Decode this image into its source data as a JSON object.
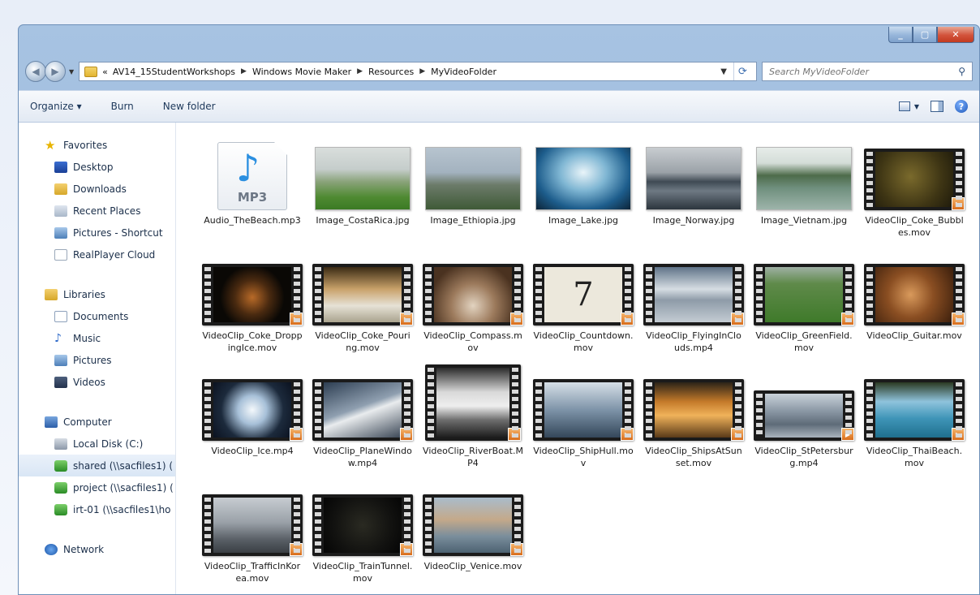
{
  "window": {
    "address": {
      "overflow": "«",
      "crumbs": [
        "AV14_15StudentWorkshops",
        "Windows Movie Maker",
        "Resources",
        "MyVideoFolder"
      ]
    },
    "search_placeholder": "Search MyVideoFolder"
  },
  "toolbar": {
    "organize": "Organize ▾",
    "burn": "Burn",
    "new_folder": "New folder"
  },
  "navpane": {
    "favorites": {
      "title": "Favorites",
      "items": [
        "Desktop",
        "Downloads",
        "Recent Places",
        "Pictures - Shortcut",
        "RealPlayer Cloud"
      ]
    },
    "libraries": {
      "title": "Libraries",
      "items": [
        "Documents",
        "Music",
        "Pictures",
        "Videos"
      ]
    },
    "computer": {
      "title": "Computer",
      "items": [
        "Local Disk (C:)",
        "shared (\\\\sacfiles1) (",
        "project (\\\\sacfiles1) (",
        "irt-01 (\\\\sacfiles1\\ho"
      ]
    },
    "network": "Network"
  },
  "files": [
    "Audio_TheBeach.mp3",
    "Image_CostaRica.jpg",
    "Image_Ethiopia.jpg",
    "Image_Lake.jpg",
    "Image_Norway.jpg",
    "Image_Vietnam.jpg",
    "VideoClip_Coke_Bubbles.mov",
    "VideoClip_Coke_DroppingIce.mov",
    "VideoClip_Coke_Pouring.mov",
    "VideoClip_Compass.mov",
    "VideoClip_Countdown.mov",
    "VideoClip_FlyingInClouds.mp4",
    "VideoClip_GreenField.mov",
    "VideoClip_Guitar.mov",
    "VideoClip_Ice.mp4",
    "VideoClip_PlaneWindow.mp4",
    "VideoClip_RiverBoat.MP4",
    "VideoClip_ShipHull.mov",
    "VideoClip_ShipsAtSunset.mov",
    "VideoClip_StPetersburg.mp4",
    "VideoClip_ThaiBeach.mov",
    "VideoClip_TrafficInKorea.mov",
    "VideoClip_TrainTunnel.mov",
    "VideoClip_Venice.mov"
  ],
  "mp3_badge": "MP3",
  "countdown_digit": "7"
}
